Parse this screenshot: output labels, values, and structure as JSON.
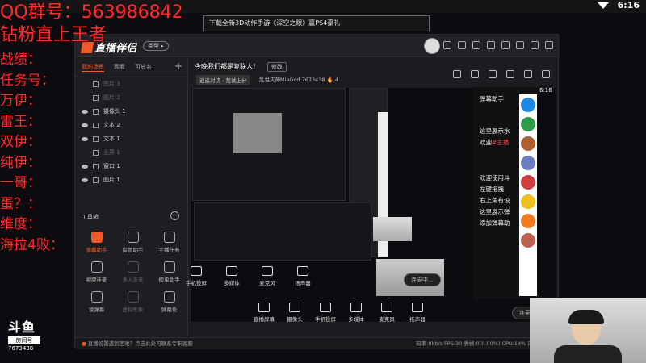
{
  "status": {
    "time": "6:16"
  },
  "notice": {
    "text": "下载全新3D动作手游《深空之眼》赢PS4豪礼"
  },
  "overlay": {
    "qq": "QQ群号：563986842",
    "fans": "钻粉直上王者",
    "record_label": "战绩：",
    "items": [
      "任务号：",
      "万伊：",
      "雷王：",
      "双伊：",
      "纯伊：",
      "一哥：",
      "蛋？：",
      "维度：",
      "海拉4败："
    ]
  },
  "douyu": {
    "logo": "斗鱼",
    "room_label": "房间号",
    "room_id": "7673438"
  },
  "app": {
    "brand": "直播伴侣",
    "type_pill": "类型 ▸",
    "tabs": [
      "我的场景",
      "观看",
      "可放名"
    ],
    "layers": [
      {
        "label": "图片 3",
        "dim": true
      },
      {
        "label": "图片 2",
        "dim": true
      },
      {
        "label": "摄像头 1",
        "dim": false
      },
      {
        "label": "文本 2",
        "dim": false
      },
      {
        "label": "文本 1",
        "dim": false
      },
      {
        "label": "全屏 1",
        "dim": true
      },
      {
        "label": "窗口 1",
        "dim": false
      },
      {
        "label": "图片 1",
        "dim": false
      }
    ],
    "toolbox_title": "工具箱",
    "tools": [
      {
        "label": "弹幕助手",
        "state": "active"
      },
      {
        "label": "房管助手",
        "state": ""
      },
      {
        "label": "主播任务",
        "state": ""
      },
      {
        "label": "视频连麦",
        "state": ""
      },
      {
        "label": "多人连麦",
        "state": "dim"
      },
      {
        "label": "榜单助手",
        "state": ""
      },
      {
        "label": "读弹幕",
        "state": ""
      },
      {
        "label": "虚拟形象",
        "state": "dim"
      },
      {
        "label": "弹幕秀",
        "state": ""
      }
    ],
    "room_title": "今晚我们都是复联人！",
    "edit_label": "修改",
    "category": "逍遥对决 - 荒试上分",
    "room_meta": "乱世灭神MieGod  7673438  🔥 4",
    "controls": [
      "手机投屏",
      "多媒体",
      "麦克风",
      "扬声器"
    ],
    "connect_label": "连麦中...",
    "controls2": [
      "直播屏幕",
      "摄像头",
      "手机投屏",
      "多媒体",
      "麦克风",
      "扬声器"
    ],
    "connect_label2": "连麦",
    "bottom_warn": "直播设置遇到困难？点击此处可联系专职客服",
    "bottom_stats": "码率:0kb/s   FPS:30   丢帧:0(0.00%)   CPU:14%   内存:41%"
  },
  "chat": {
    "time": "6:16",
    "lines": [
      {
        "text": "弹幕助手",
        "red": false
      },
      {
        "text": "这里展示水",
        "red": false
      },
      {
        "text": "欢迎",
        "red": false,
        "red_part": "#主播"
      },
      {
        "text": "欢迎使用斗",
        "red": false
      },
      {
        "text": "左键拖拽",
        "red": false
      },
      {
        "text": "右上角有设",
        "red": false
      },
      {
        "text": "这里展示弹",
        "red": false
      },
      {
        "text": "添加弹幕助",
        "red": false
      }
    ]
  }
}
